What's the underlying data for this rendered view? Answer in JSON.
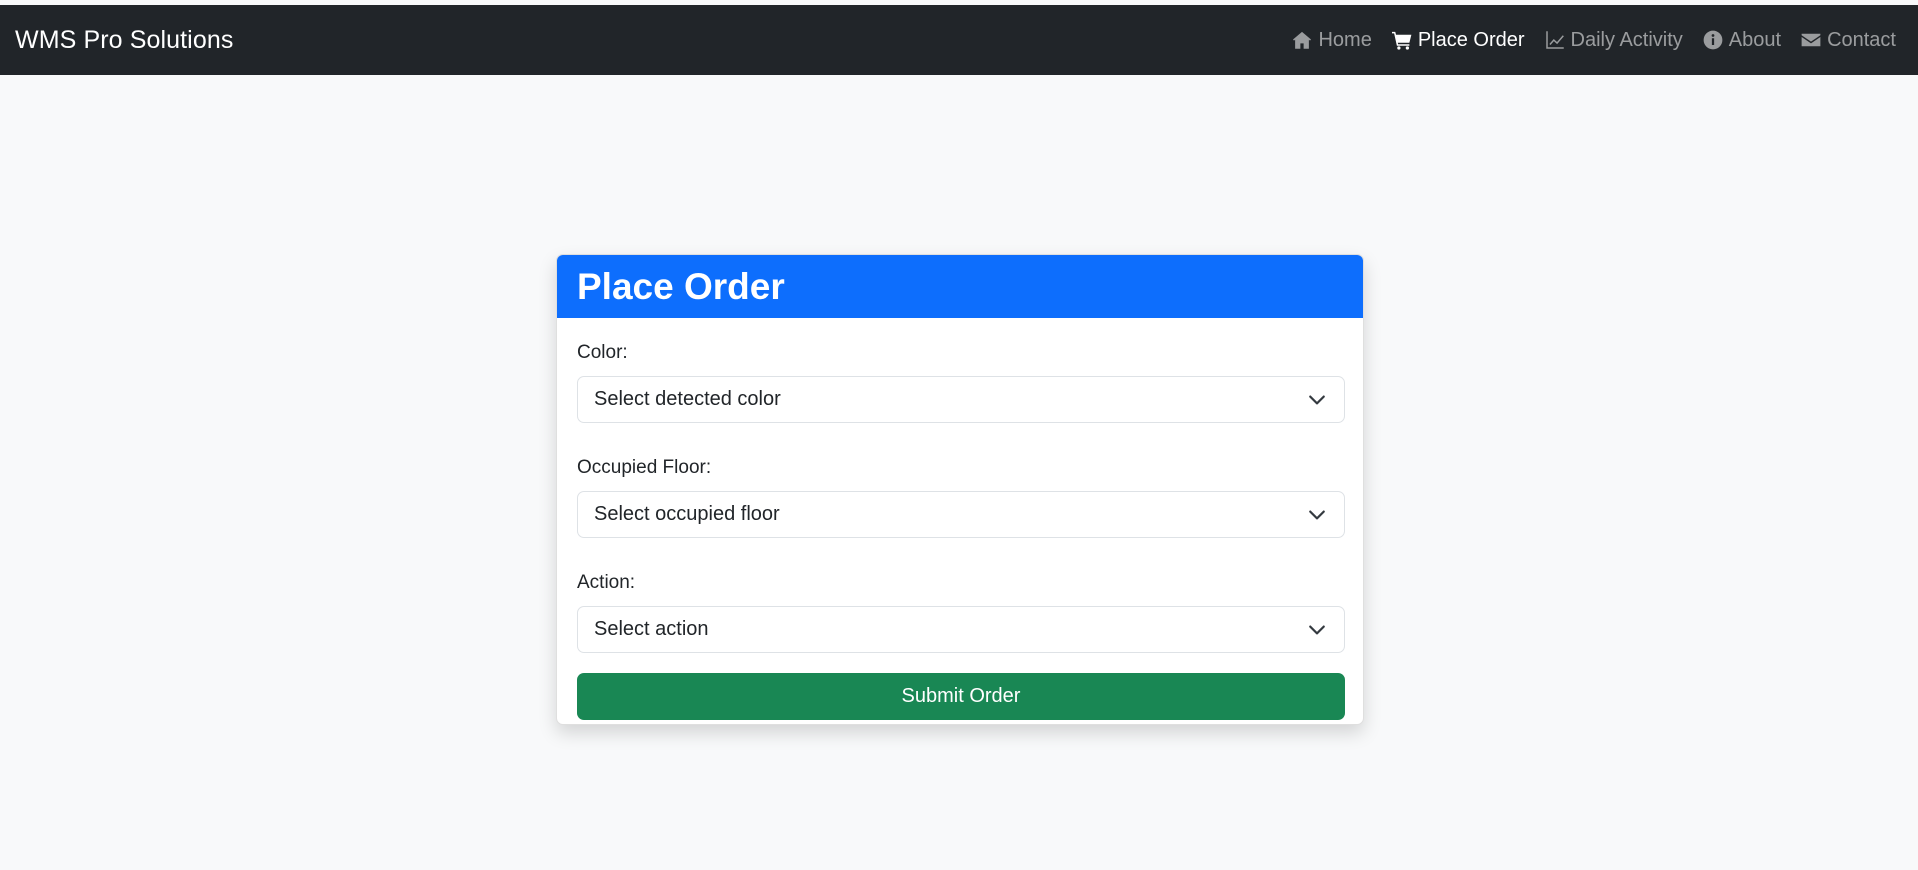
{
  "navbar": {
    "brand": "WMS Pro Solutions",
    "links": [
      {
        "label": "Home",
        "icon": "house-icon",
        "active": false
      },
      {
        "label": "Place Order",
        "icon": "cart-icon",
        "active": true
      },
      {
        "label": "Daily Activity",
        "icon": "chart-line-icon",
        "active": false
      },
      {
        "label": "About",
        "icon": "info-icon",
        "active": false
      },
      {
        "label": "Contact",
        "icon": "envelope-icon",
        "active": false
      }
    ]
  },
  "form": {
    "title": "Place Order",
    "fields": [
      {
        "label": "Color:",
        "value": "Select detected color"
      },
      {
        "label": "Occupied Floor:",
        "value": "Select occupied floor"
      },
      {
        "label": "Action:",
        "value": "Select action"
      }
    ],
    "submit_label": "Submit Order"
  },
  "colors": {
    "navbar_bg": "#212529",
    "header_bg": "#0d6efd",
    "submit_bg": "#198754",
    "page_bg": "#f8f9fa"
  }
}
